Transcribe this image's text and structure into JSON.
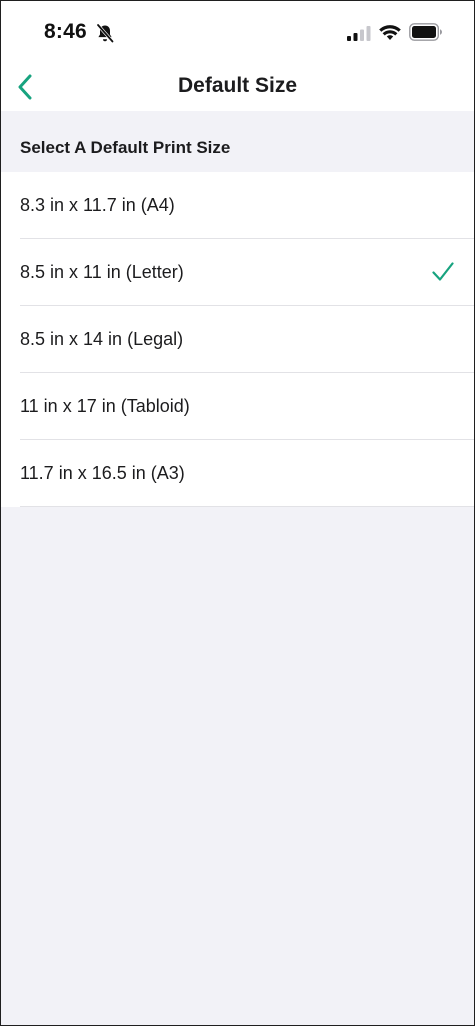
{
  "status_bar": {
    "time": "8:46",
    "icons": [
      "bell-slash-icon",
      "cellular-signal-icon",
      "wifi-icon",
      "battery-icon"
    ]
  },
  "nav": {
    "title": "Default Size",
    "back_icon": "chevron-left-icon"
  },
  "section": {
    "header": "Select A Default Print Size"
  },
  "sizes": [
    {
      "label": "8.3 in x 11.7 in (A4)",
      "selected": false
    },
    {
      "label": "8.5 in x 11 in (Letter)",
      "selected": true
    },
    {
      "label": "8.5 in x 14 in (Legal)",
      "selected": false
    },
    {
      "label": "11 in x 17 in (Tabloid)",
      "selected": false
    },
    {
      "label": "11.7 in x 16.5 in (A3)",
      "selected": false
    }
  ],
  "colors": {
    "accent": "#17a37f",
    "background": "#f2f2f7",
    "surface": "#ffffff",
    "text": "#1c1c1e"
  }
}
